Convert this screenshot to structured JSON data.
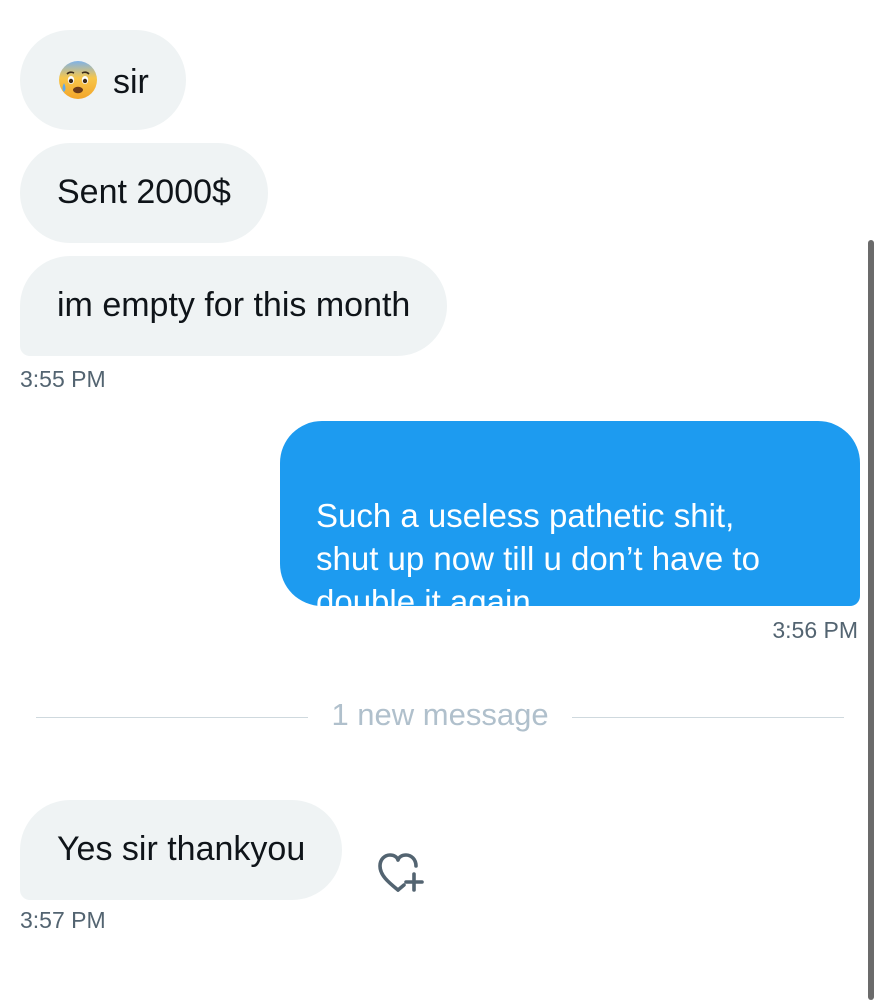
{
  "messages": [
    {
      "text": "sir",
      "icon": "anxious-face-with-sweat-icon"
    },
    {
      "text": "Sent 2000$"
    },
    {
      "text": "im empty for this month"
    },
    {
      "text": "Such a useless pathetic shit,\nshut up  now till u don’t have to double it again."
    },
    {
      "text": "Yes sir thankyou"
    }
  ],
  "timestamps": [
    "3:55 PM",
    "3:56 PM",
    "3:57 PM"
  ],
  "divider": {
    "label": "1 new message"
  },
  "colors": {
    "incoming_bubble": "#eff3f4",
    "outgoing_bubble": "#1d9bf0",
    "timestamp": "#536471",
    "divider_text": "#b0c0cc"
  },
  "icons": {
    "react": "heart-add-icon"
  }
}
